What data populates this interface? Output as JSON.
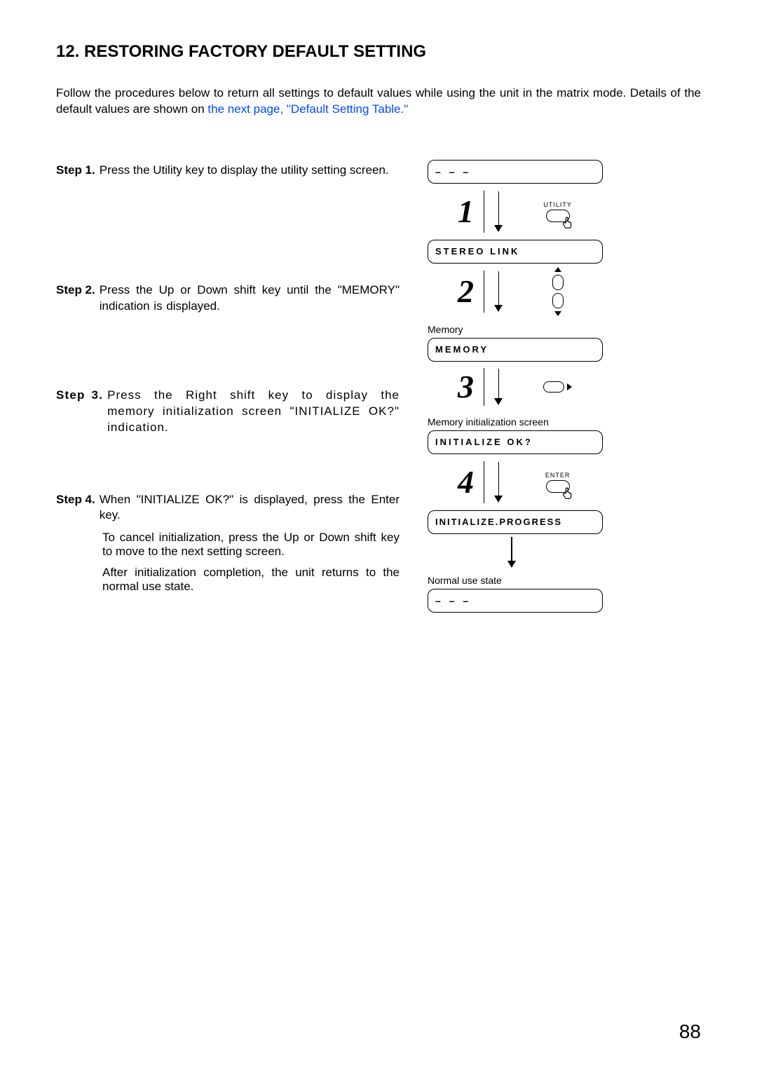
{
  "title": "12. RESTORING FACTORY DEFAULT SETTING",
  "intro_part1": "Follow the procedures below to return all settings to default values while using the unit in the matrix mode. Details of the default values are shown on ",
  "intro_link": "the next page, \"Default Setting Table.\"",
  "steps": {
    "s1": {
      "label": "Step 1.",
      "text": "Press the Utility key to display the utility setting screen."
    },
    "s2": {
      "label": "Step 2.",
      "text": "Press the Up or Down shift key until the \"MEMORY\" indication is displayed."
    },
    "s3": {
      "label": "Step 3.",
      "text": "Press the Right shift key to display the memory initialization screen \"INITIALIZE OK?\" indication."
    },
    "s4": {
      "label": "Step 4.",
      "text": "When \"INITIALIZE OK?\" is displayed, press the Enter key.",
      "sub1": "To cancel initialization, press the Up or Down shift key to move to the next setting screen.",
      "sub2": "After initialization completion, the unit returns to the normal use state."
    }
  },
  "diagram": {
    "dash": "– – –",
    "num1": "1",
    "num2": "2",
    "num3": "3",
    "num4": "4",
    "utility_label": "UTILITY",
    "enter_label": "ENTER",
    "lcd_stereo": "STEREO  LINK",
    "memory_caption": "Memory",
    "lcd_memory": "MEMORY",
    "mem_init_caption": "Memory initialization screen",
    "lcd_init_ok": "INITIALIZE OK?",
    "lcd_init_prog": "INITIALIZE.PROGRESS",
    "normal_caption": "Normal use state"
  },
  "page_number": "88"
}
